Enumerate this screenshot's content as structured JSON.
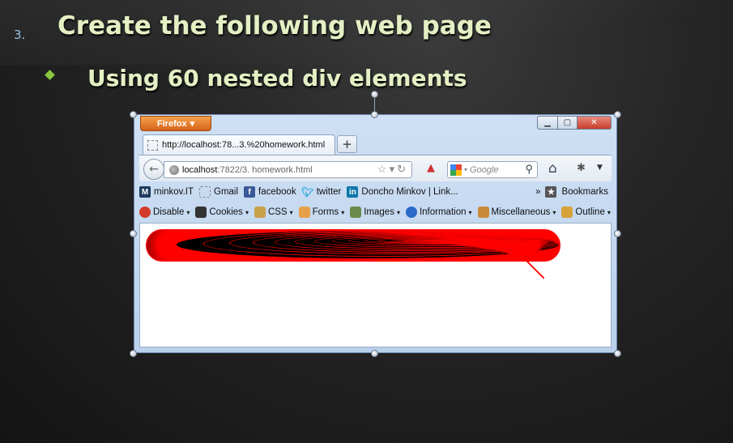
{
  "slide": {
    "number": "3.",
    "title": "Create the following web page",
    "bullet": "Using 60 nested div elements"
  },
  "browser": {
    "menu_button": "Firefox",
    "tab_title": "http://localhost:78...3.%20homework.html",
    "new_tab": "+",
    "url_host": "localhost",
    "url_rest": ":7822/3. homework.html",
    "search_placeholder": "Google",
    "bookmarks": [
      {
        "label": "minkov.IT",
        "icon": "m-icon",
        "color": "#1f3a5c"
      },
      {
        "label": "Gmail",
        "icon": "page-icon",
        "color": "#ffffff"
      },
      {
        "label": "facebook",
        "icon": "facebook-icon",
        "color": "#3b5998"
      },
      {
        "label": "twitter",
        "icon": "twitter-icon",
        "color": "#2fa6e0"
      },
      {
        "label": "Doncho Minkov | Link...",
        "icon": "linkedin-icon",
        "color": "#0e76a8"
      }
    ],
    "bookmarks_overflow": "»",
    "bookmarks_menu": "Bookmarks",
    "devtools": [
      {
        "label": "Disable",
        "color": "#d43b2a"
      },
      {
        "label": "Cookies",
        "color": "#333333"
      },
      {
        "label": "CSS",
        "color": "#8a6a2a"
      },
      {
        "label": "Forms",
        "color": "#c98a2a"
      },
      {
        "label": "Images",
        "color": "#5a7a3a"
      },
      {
        "label": "Information",
        "color": "#2a6ac8"
      },
      {
        "label": "Miscellaneous",
        "color": "#c88a3a"
      },
      {
        "label": "Outline",
        "color": "#d8a23a"
      }
    ],
    "colors": {
      "accent_orange": "#e67e22",
      "nested_fill": "#000000",
      "nested_border": "#ff0000",
      "outer_fill": "#ff0000"
    }
  }
}
